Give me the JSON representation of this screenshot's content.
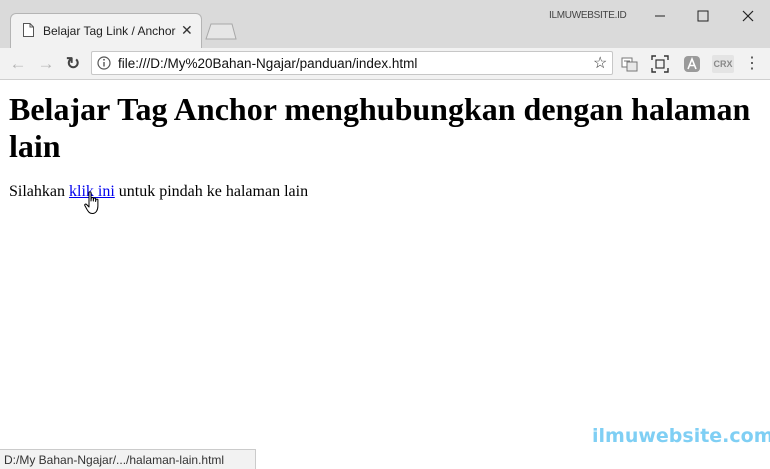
{
  "window": {
    "label": "ILMUWEBSITE.ID",
    "minimize_icon": "minimize-icon",
    "maximize_icon": "maximize-icon",
    "close_icon": "close-icon"
  },
  "tab": {
    "title": "Belajar Tag Link / Anchor",
    "close": "✕"
  },
  "toolbar": {
    "back": "←",
    "forward": "→",
    "reload": "↻",
    "url": "file:///D:/My%20Bahan-Ngajar/panduan/index.html",
    "bookmark_star": "☆",
    "menu": "⋮",
    "extensions": [
      "translate-icon",
      "screen-capture-icon",
      "extension-a-icon",
      "crx-icon"
    ],
    "crx_label": "CRX"
  },
  "page": {
    "heading": "Belajar Tag Anchor menghubungkan dengan halaman lain",
    "paragraph_before": "Silahkan ",
    "link_text": "klik ini",
    "paragraph_after": " untuk pindah ke halaman lain"
  },
  "status_bar": {
    "link_url": "D:/My Bahan-Ngajar/.../halaman-lain.html"
  },
  "watermark": "ilmuwebsite.com"
}
